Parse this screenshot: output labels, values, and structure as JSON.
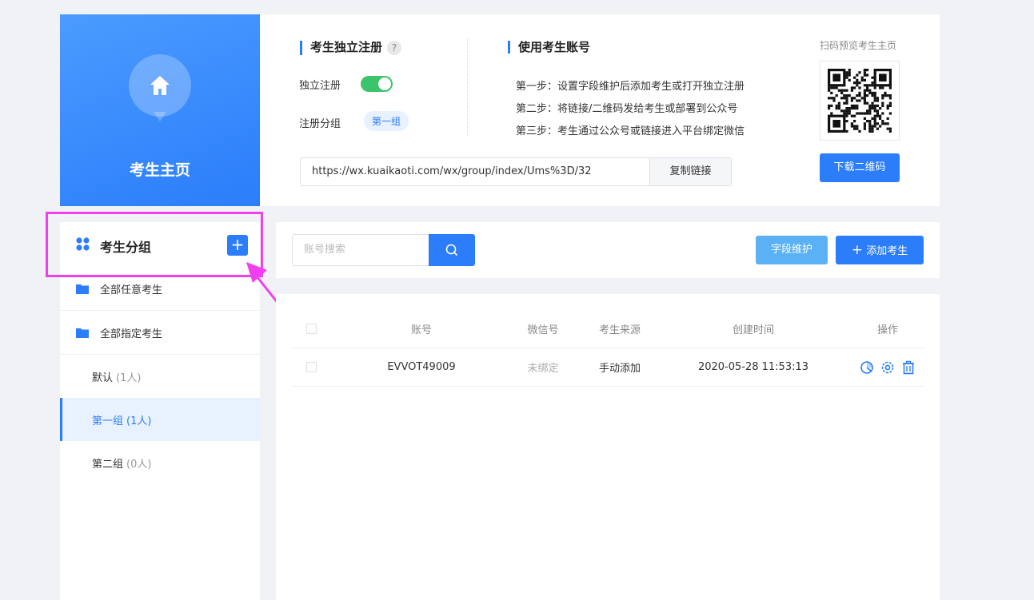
{
  "hero": {
    "title": "考生主页",
    "icon": "home-icon"
  },
  "register": {
    "title": "考生独立注册",
    "help": "?",
    "independent_label": "独立注册",
    "independent_enabled": true,
    "group_label": "注册分组",
    "group_value": "第一组"
  },
  "usage": {
    "title": "使用考生账号",
    "steps": [
      "第一步：设置字段维护后添加考生或打开独立注册",
      "第二步：将链接/二维码发给考生或部署到公众号",
      "第三步：考生通过公众号或链接进入平台绑定微信"
    ]
  },
  "link": {
    "url": "https://wx.kuaikaoti.com/wx/group/index/Ums%3D/32",
    "copy_label": "复制链接"
  },
  "qr": {
    "hint": "扫码预览考生主页",
    "download_label": "下载二维码"
  },
  "sidebar": {
    "title": "考生分组",
    "add_label": "+",
    "items": [
      {
        "label": "全部任意考生",
        "count": ""
      },
      {
        "label": "全部指定考生",
        "count": ""
      },
      {
        "label": "默认",
        "count": "(1人)"
      },
      {
        "label": "第一组",
        "count": "(1人)"
      },
      {
        "label": "第二组",
        "count": "(0人)"
      }
    ]
  },
  "toolbar": {
    "search_placeholder": "账号搜索",
    "field_label": "字段维护",
    "add_label": "添加考生",
    "add_prefix": "+"
  },
  "table": {
    "columns": [
      "账号",
      "微信号",
      "考生来源",
      "创建时间",
      "操作"
    ],
    "rows": [
      {
        "account": "EVVOT49009",
        "wechat": "未绑定",
        "source": "手动添加",
        "created": "2020-05-28 11:53:13"
      }
    ]
  },
  "colors": {
    "primary": "#2b7dfa",
    "highlight": "#f03ef0",
    "switch_on": "#3cc46a"
  }
}
